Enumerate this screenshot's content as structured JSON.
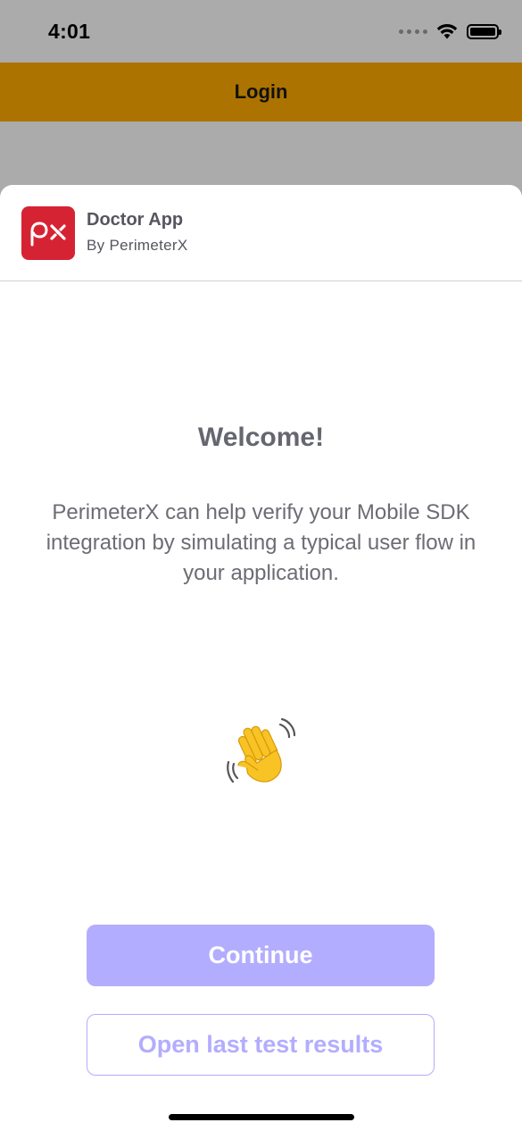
{
  "status_bar": {
    "time": "4:01",
    "icons": [
      "signal-dots-icon",
      "wifi-icon",
      "battery-icon"
    ]
  },
  "nav_bar": {
    "title": "Login",
    "color": "#ad7300"
  },
  "sheet": {
    "app_icon": "perimeterx-logo-icon",
    "app_icon_color": "#d62333",
    "app_name": "Doctor App",
    "app_by": "By PerimeterX",
    "welcome": "Welcome!",
    "description": "PerimeterX can help verify your Mobile SDK integration by simulating a typical user flow in your application.",
    "illustration": "waving-hand-icon",
    "continue_label": "Continue",
    "results_label": "Open last test results",
    "accent": "#b3adff"
  }
}
